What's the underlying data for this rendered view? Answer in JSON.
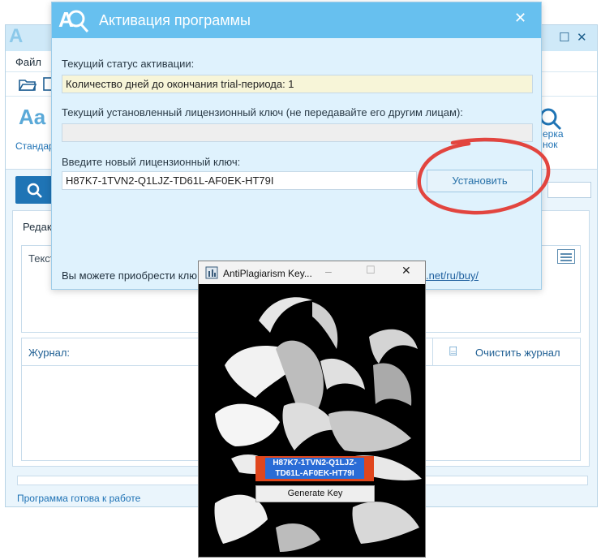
{
  "main": {
    "menu": {
      "file": "Файл"
    },
    "ribbon": {
      "standard_label": "Стандар",
      "standard_icon_text": "Aa",
      "check_label_line1": "ерка",
      "check_label_line2": "нок"
    },
    "editor": {
      "label": "Редак",
      "text_label": "Текст"
    },
    "journal": {
      "label": "Журнал:",
      "clear_button": "Очистить журнал"
    },
    "status": "Программа готова к работе"
  },
  "activation": {
    "title": "Активация программы",
    "status_label": "Текущий статус активации:",
    "status_value": "Количество дней до окончания trial-периода: 1",
    "current_key_label": "Текущий установленный лицензионный ключ (не передавайте его другим лицам):",
    "current_key_value": "",
    "new_key_label": "Введите новый лицензионный ключ:",
    "new_key_value": "H87K7-1TVN2-Q1LJZ-TD61L-AF0EK-HT79I",
    "install_button": "Установить",
    "buy_text": "Вы можете приобрести клю",
    "buy_link": ".net/ru/buy/"
  },
  "keygen": {
    "title": "AntiPlagiarism Key...",
    "key_line1": "H87K7-1TVN2-Q1LJZ-",
    "key_line2": "TD61L-AF0EK-HT79I",
    "generate_button": "Generate Key"
  },
  "colors": {
    "accent": "#67c0ef",
    "annotation": "#e2453f",
    "key_highlight": "#e0461d"
  }
}
